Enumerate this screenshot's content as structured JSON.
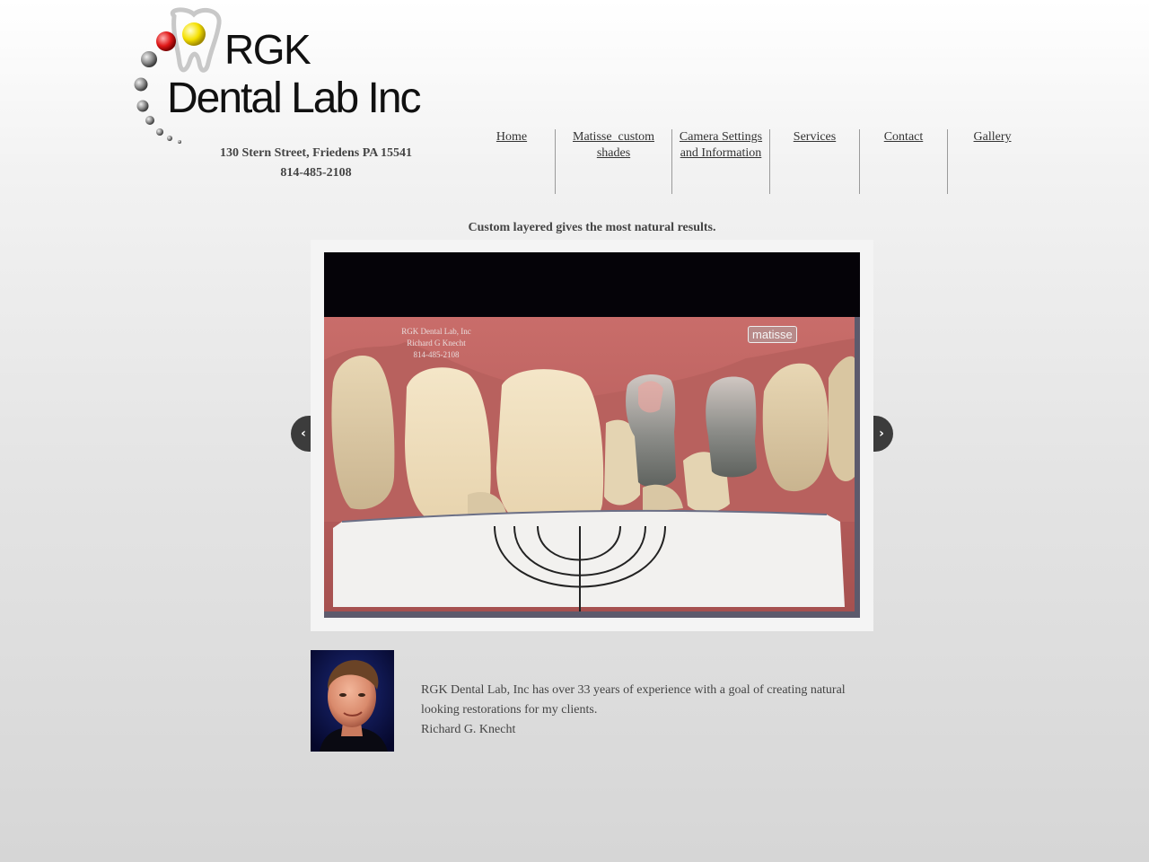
{
  "logo": {
    "line1": "RGK",
    "line2": "Dental Lab Inc"
  },
  "address": {
    "street": "130 Stern Street, Friedens PA 15541",
    "phone": "814-485-2108"
  },
  "nav": {
    "items": [
      {
        "label": "Home"
      },
      {
        "label": "Matisse_custom shades"
      },
      {
        "label": "Camera Settings and Information"
      },
      {
        "label": "Services"
      },
      {
        "label": "Contact"
      },
      {
        "label": "Gallery"
      }
    ]
  },
  "slideshow": {
    "caption": "Custom layered gives the most natural results.",
    "watermark": {
      "line1": "RGK Dental Lab, Inc",
      "line2": "Richard G Knecht",
      "line3": "814-485-2108"
    },
    "brand": "matisse",
    "prev_icon": "chevron-left-icon",
    "next_icon": "chevron-right-icon"
  },
  "about": {
    "text": "RGK Dental Lab, Inc has over 33 years of experience with a goal of creating natural looking restorations for my clients.",
    "signature": "Richard G. Knecht"
  },
  "colors": {
    "background_top": "#ffffff",
    "background_bottom": "#d6d6d6",
    "text": "#444444",
    "arrow": "#3c3c3c",
    "portrait_bg": "#0b0f3a"
  }
}
